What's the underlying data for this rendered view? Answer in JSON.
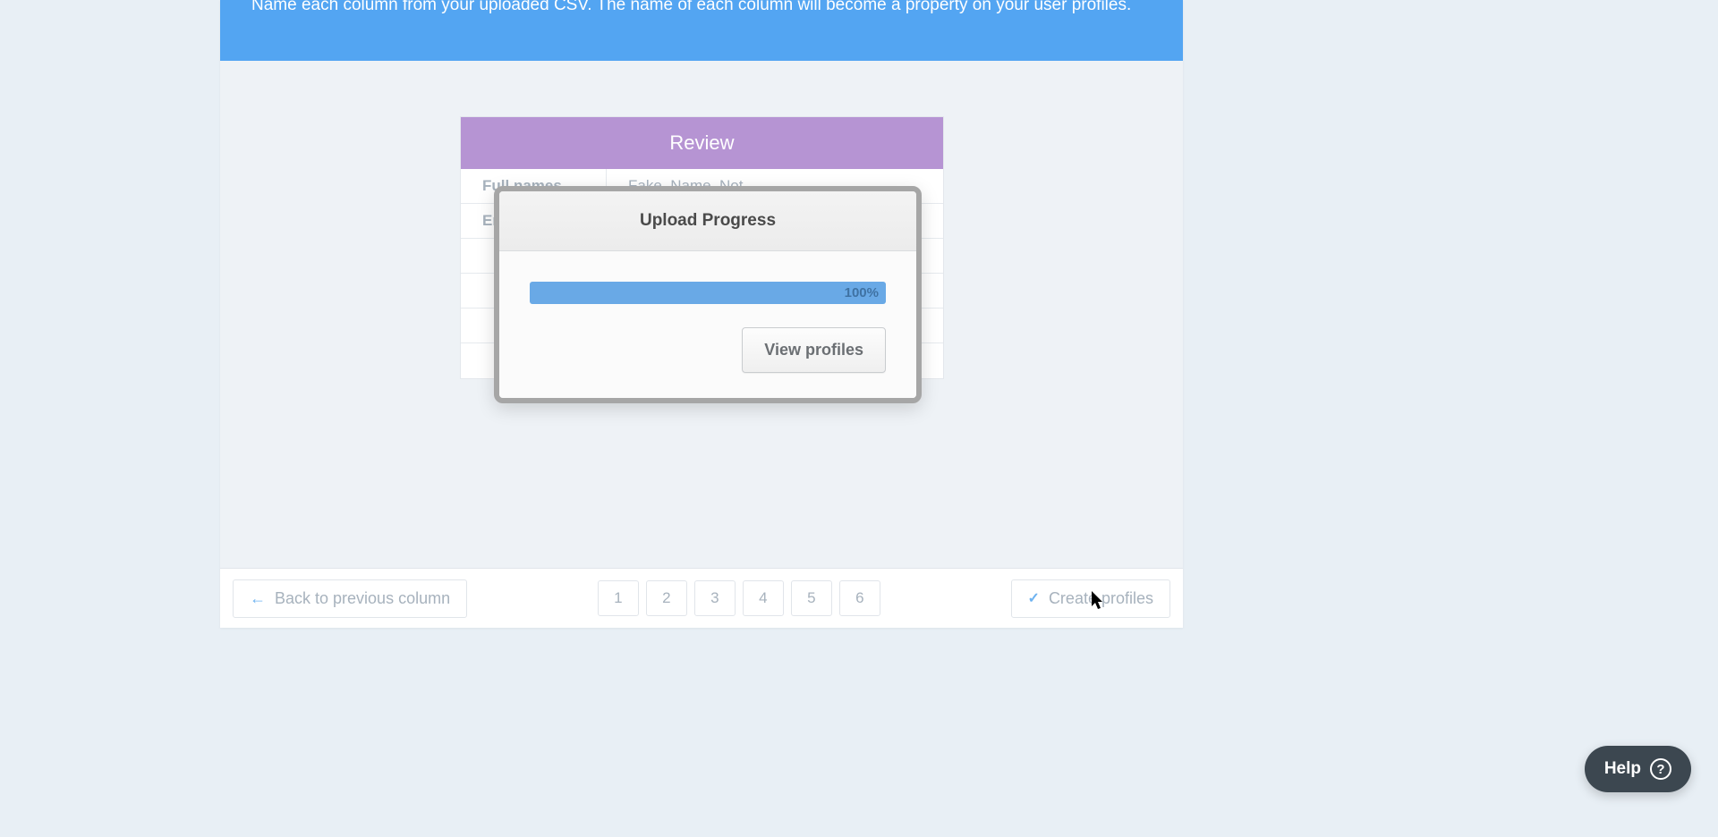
{
  "banner": {
    "text": "Name each column from your uploaded CSV. The name of each column will become a property on your user profiles."
  },
  "review": {
    "title": "Review",
    "rows": [
      {
        "label": "Full names",
        "value": "Fake, Name, Not ..."
      },
      {
        "label": "Em",
        "value": ""
      },
      {
        "label": "",
        "value": ""
      },
      {
        "label": "",
        "value": ""
      },
      {
        "label": "",
        "value": ""
      },
      {
        "label": "",
        "value": ""
      }
    ]
  },
  "modal": {
    "title": "Upload Progress",
    "progress_text": "100%",
    "view_btn": "View profiles"
  },
  "footer": {
    "back_label": "Back to previous column",
    "pages": [
      "1",
      "2",
      "3",
      "4",
      "5",
      "6"
    ],
    "create_label": "Create profiles"
  },
  "help": {
    "label": "Help",
    "icon": "?"
  }
}
